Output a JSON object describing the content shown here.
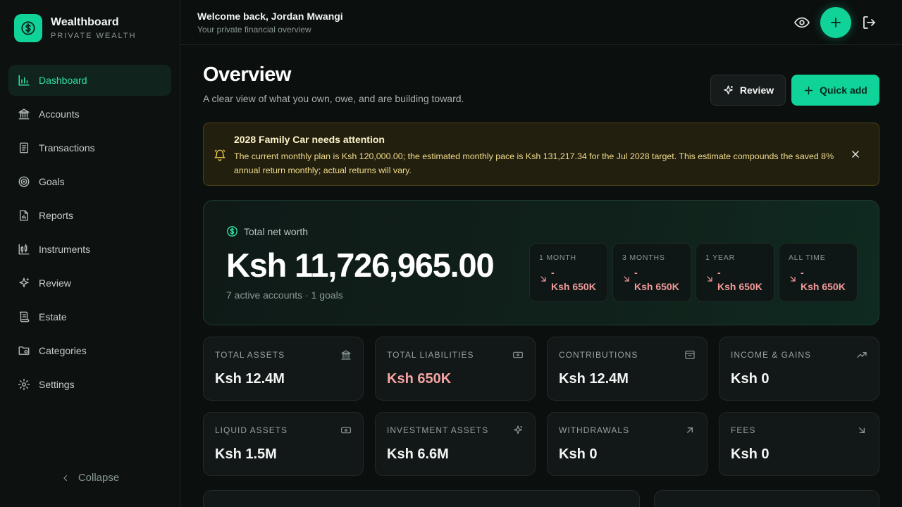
{
  "brand": {
    "name": "Wealthboard",
    "subtitle": "PRIVATE WEALTH",
    "logo_icon": "dollar-circle-icon"
  },
  "nav": {
    "items": [
      {
        "label": "Dashboard",
        "icon": "bar-chart-icon",
        "active": true
      },
      {
        "label": "Accounts",
        "icon": "bank-icon"
      },
      {
        "label": "Transactions",
        "icon": "receipt-icon"
      },
      {
        "label": "Goals",
        "icon": "target-icon"
      },
      {
        "label": "Reports",
        "icon": "report-icon"
      },
      {
        "label": "Instruments",
        "icon": "candlestick-icon"
      },
      {
        "label": "Review",
        "icon": "sparkles-icon"
      },
      {
        "label": "Estate",
        "icon": "scroll-icon"
      },
      {
        "label": "Categories",
        "icon": "folder-icon"
      },
      {
        "label": "Settings",
        "icon": "gear-icon"
      }
    ],
    "collapse_label": "Collapse"
  },
  "header": {
    "welcome": "Welcome back, Jordan Mwangi",
    "subtitle": "Your private financial overview"
  },
  "page": {
    "title": "Overview",
    "subtitle": "A clear view of what you own, owe, and are building toward.",
    "review_button": "Review",
    "quick_add_button": "Quick add"
  },
  "alert": {
    "title": "2028 Family Car needs attention",
    "body": "The current monthly plan is Ksh 120,000.00; the estimated monthly pace is Ksh 131,217.34 for the Jul 2028 target. This estimate compounds the saved 8% annual return monthly; actual returns will vary."
  },
  "net_worth": {
    "label": "Total net worth",
    "value": "Ksh 11,726,965.00",
    "meta": "7 active accounts · 1 goals",
    "periods": [
      {
        "label": "1 MONTH",
        "sign": "-",
        "value": "Ksh 650K"
      },
      {
        "label": "3 MONTHS",
        "sign": "-",
        "value": "Ksh 650K"
      },
      {
        "label": "1 YEAR",
        "sign": "-",
        "value": "Ksh 650K"
      },
      {
        "label": "ALL TIME",
        "sign": "-",
        "value": "Ksh 650K"
      }
    ]
  },
  "stats": [
    {
      "label": "TOTAL ASSETS",
      "value": "Ksh 12.4M",
      "icon": "bank-icon"
    },
    {
      "label": "TOTAL LIABILITIES",
      "value": "Ksh 650K",
      "icon": "banknote-icon",
      "negative": true
    },
    {
      "label": "CONTRIBUTIONS",
      "value": "Ksh 12.4M",
      "icon": "archive-icon"
    },
    {
      "label": "INCOME & GAINS",
      "value": "Ksh 0",
      "icon": "trending-up-icon"
    },
    {
      "label": "LIQUID ASSETS",
      "value": "Ksh 1.5M",
      "icon": "banknote-icon"
    },
    {
      "label": "INVESTMENT ASSETS",
      "value": "Ksh 6.6M",
      "icon": "sparkles-icon"
    },
    {
      "label": "WITHDRAWALS",
      "value": "Ksh 0",
      "icon": "arrow-up-right-icon"
    },
    {
      "label": "FEES",
      "value": "Ksh 0",
      "icon": "arrow-down-right-icon"
    }
  ],
  "colors": {
    "accent": "#10d39a",
    "negative": "#f39a9a",
    "warning": "#f2dc8a"
  }
}
